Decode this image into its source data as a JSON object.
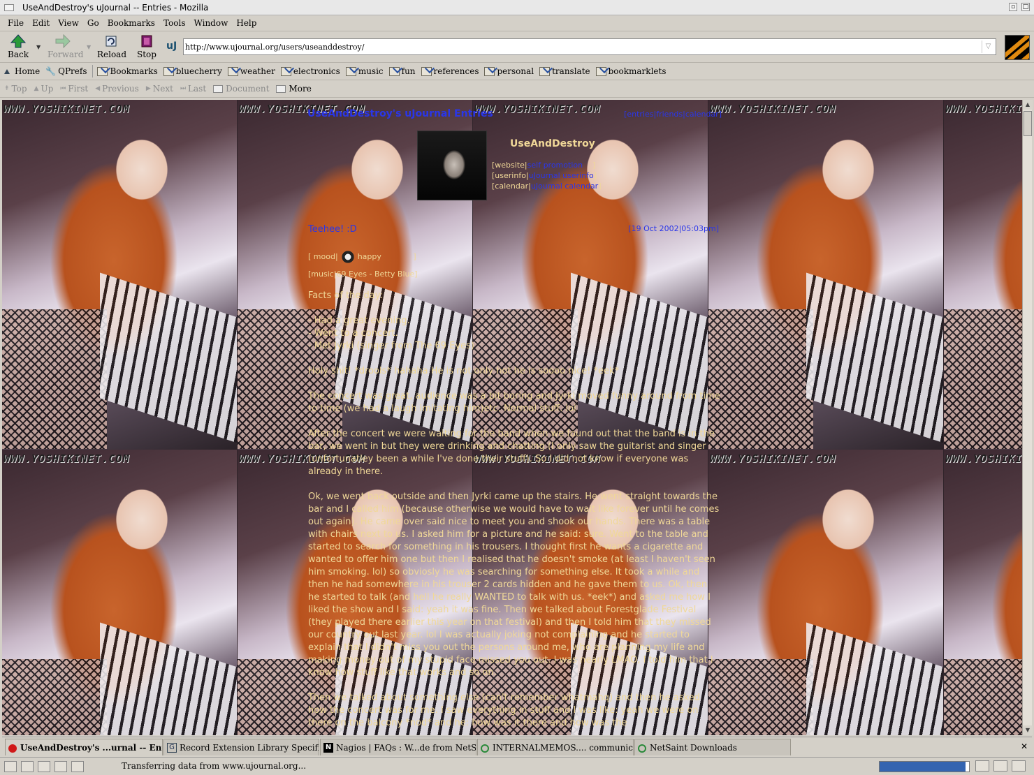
{
  "window": {
    "title": "UseAndDestroy's uJournal -- Entries - Mozilla"
  },
  "menu": [
    "File",
    "Edit",
    "View",
    "Go",
    "Bookmarks",
    "Tools",
    "Window",
    "Help"
  ],
  "nav": {
    "back": "Back",
    "forward": "Forward",
    "reload": "Reload",
    "stop": "Stop"
  },
  "url": "http://www.ujournal.org/users/useanddestroy/",
  "url_icon": "uJ",
  "bookmarks": {
    "home": "Home",
    "qprefs": "QPrefs",
    "bookmarks": "Bookmarks",
    "folders": [
      "bluecherry",
      "weather",
      "electronics",
      "music",
      "fun",
      "references",
      "personal",
      "translate",
      "bookmarklets"
    ]
  },
  "sitenav": {
    "top": "Top",
    "up": "Up",
    "first": "First",
    "previous": "Previous",
    "next": "Next",
    "last": "Last",
    "document": "Document",
    "more": "More"
  },
  "watermark": "WWW.YOSHIKINET.COM",
  "journal": {
    "title": "UseAndDestroy's uJournal Entries",
    "nav": {
      "open": "[",
      "entries": "entries",
      "sep1": "|",
      "friends": "friends",
      "sep2": "|",
      "calendar": "calendar",
      "close": "]"
    },
    "username": "UseAndDestroy",
    "links": [
      {
        "label": "website",
        "link": "self promotion"
      },
      {
        "label": "userinfo",
        "link": "uJournal userinfo"
      },
      {
        "label": "calendar",
        "link": "uJournal calendar"
      }
    ],
    "entry": {
      "subject": "Teehee! :D",
      "date": "[19 Oct 2002|05:03pm]",
      "mood_label": "mood",
      "mood_value": "happy",
      "music_label": "music",
      "music_value": "69 Eyes - Betty Blue",
      "paragraphs": [
        "Facts of the day:",
        "- Had a great evening.\n- Went to a concert.\n- Met Jyrki (singer from The 69 Eyes)",
        "Holy shit! *drools* hahaha He is not only hot he is soooo nice! *eek*",
        "The concert was great, audience was a bit boring and Jyrki moved funny around from time to time (we had a laugh imitating him)etc. Normal stuff. lol",
        "After the concert we were waiting for the band when we found out that the band is in the bar, we went in but they were drinking and chatting (I only saw the guitarist and singer (unfortunatley been a while I've done their stuff). So I did not know if everyone was already in there.",
        "Ok, we went back outside and then Jyrki came up the stairs. He went straight towards the bar and I called him (because otherwise we would have to wait like forever until he comes out again). He came over said nice to meet you and shook our hands. There was a table with chairs next to us. I asked him for a picture and he said: sure. Went to the table and started to search for something in his trousers. I thought first he wants a cigarette and wanted to offer him one but then I realised that he doesn't smoke (at least I haven't seen him smoking. lol) so obviosly he was searching for something else. It took a while and then he had somewhere in his trouser 2 cards hidden and he gave them to us. Ok, then he started to talk (and hell he really WANTED to talk with us. *eek*) and asked me how I liked the show and I said: yeah it was fine. Then we talked about Forestglade Festival (they played there earlier this year on that festival) and then I told him that they missed our country out last year. lol I was actually joking not complaining and he started to explain that I didn't miss you out the persons around me, who are planning my life and making money out of my stupid face missed you out. I was nearly LMAO, I told him that I know how stuff like that works and so on.",
        "Then we talked about something else (can't remember whatmahq) and then he asked how the concert was for me. I saw everything in stuff and I was like: yeah we were on there on the balcony *nod* and he: how was it there and how was the"
      ]
    }
  },
  "tabs": [
    "UseAndDestroy's ...urnal -- Entries",
    "Record Extension Library Specification",
    "Nagios | FAQs : W...de from NetSaint?",
    "INTERNALMEMOS.... communication",
    "NetSaint Downloads"
  ],
  "status": {
    "text": "Transferring data from www.ujournal.org...",
    "progress": 0.96
  },
  "colors": {
    "link": "#2a36e8",
    "journal_text": "#f0d898",
    "chrome": "#d4d0c8"
  }
}
